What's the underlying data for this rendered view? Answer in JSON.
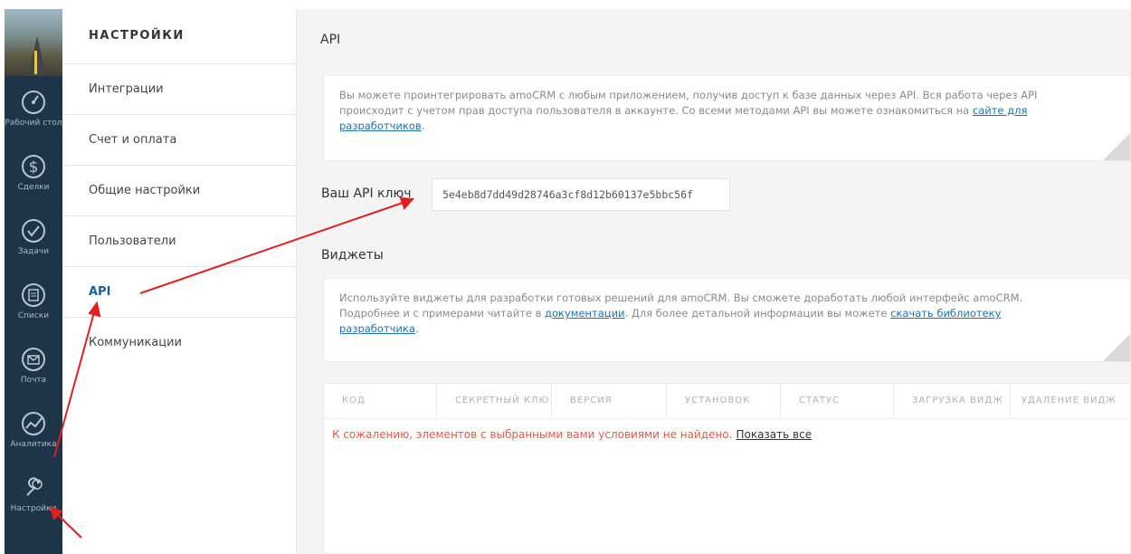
{
  "nav": {
    "items": [
      {
        "icon": "dashboard-icon",
        "label": "Рабочий стол"
      },
      {
        "icon": "dollar-icon",
        "label": "Сделки"
      },
      {
        "icon": "checkmark-icon",
        "label": "Задачи"
      },
      {
        "icon": "list-icon",
        "label": "Списки"
      },
      {
        "icon": "mail-icon",
        "label": "Почта"
      },
      {
        "icon": "analytics-icon",
        "label": "Аналитика"
      },
      {
        "icon": "wrench-icon",
        "label": "Настройки"
      }
    ]
  },
  "menu": {
    "title": "НАСТРОЙКИ",
    "items": [
      "Интеграции",
      "Счет и оплата",
      "Общие настройки",
      "Пользователи",
      "API",
      "Коммуникации"
    ],
    "active": "API"
  },
  "content": {
    "title": "API",
    "api_note": {
      "text": "Вы можете проинтегрировать amoCRM с любым приложением, получив доступ к базе данных через API. Вся работа через API происходит с учетом прав доступа пользователя в аккаунте. Со всеми методами API вы можете ознакомиться на ",
      "link": "сайте для разработчиков",
      "end": "."
    },
    "key_label": "Ваш API ключ",
    "key_value": "5e4eb8d7dd49d28746a3cf8d12b60137e5bbc56f",
    "widgets_title": "Виджеты",
    "widgets_note": {
      "text1": "Используйте виджеты для разработки готовых решений для amoCRM. Вы сможете доработать любой интерфейс amoCRM. Подробнее и с примерами читайте в ",
      "link1": "документации",
      "text2": ". Для более детальной информации вы можете ",
      "link2": "скачать библиотеку разработчика",
      "end": "."
    },
    "table": {
      "columns": [
        "КОД",
        "СЕКРЕТНЫЙ КЛЮ",
        "ВЕРСИЯ",
        "УСТАНОВОК",
        "СТАТУС",
        "ЗАГРУЗКА ВИДЖ",
        "УДАЛЕНИЕ ВИДЖ"
      ],
      "empty_text": "К сожалению, элементов с выбранными вами условиями не найдено.",
      "show_all": "Показать все"
    }
  },
  "colors": {
    "sidebar": "#1e3549",
    "accent_link": "#1f6fb2",
    "active_menu": "#1b5f9e",
    "error_text": "#e05a47",
    "arrow": "#e02020"
  }
}
